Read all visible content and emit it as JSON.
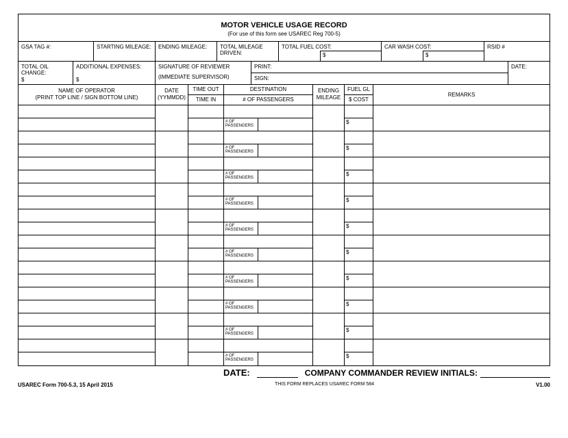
{
  "title": "MOTOR VEHICLE USAGE RECORD",
  "subtitle": "(For use of this form see USAREC Reg 700-5)",
  "labels": {
    "gsa": "GSA TAG #:",
    "start_mileage": "STARTING MILEAGE:",
    "end_mileage": "ENDING MILEAGE:",
    "total_mileage": "TOTAL MILEAGE DRIVEN:",
    "total_fuel": "TOTAL FUEL COST:",
    "car_wash": "CAR WASH COST:",
    "rsid": "RSID #",
    "total_oil": "TOTAL OIL CHANGE:",
    "add_exp": "ADDITIONAL EXPENSES:",
    "sig_rev": "SIGNATURE OF REVIEWER",
    "imm_sup": "(IMMEDIATE SUPERVISOR)",
    "print": "PRINT:",
    "sign": "SIGN:",
    "date": "DATE:",
    "dollar": "$"
  },
  "log_header": {
    "name1": "NAME OF OPERATOR",
    "name2": "(PRINT TOP LINE / SIGN BOTTOM LINE)",
    "date1": "DATE",
    "date2": "(YYMMDD)",
    "time_out": "TIME OUT",
    "time_in": "TIME IN",
    "destination": "DESTINATION",
    "num_pass": "# OF PASSENGERS",
    "end_mil1": "ENDING",
    "end_mil2": "MILEAGE",
    "fuel_gl": "FUEL GL",
    "fuel_cost": "$ COST",
    "remarks": "REMARKS"
  },
  "row_labels": {
    "pass_small": "# OF PASSENGERS",
    "dollar": "$"
  },
  "footer": {
    "date": "DATE:",
    "cc_initials": "COMPANY COMMANDER REVIEW INITIALS:",
    "form_id": "USAREC Form 700-5.3, 15 April 2015",
    "replaces": "THIS FORM REPLACES USAREC FORM 584",
    "version": "V1.00"
  },
  "row_count": 10
}
